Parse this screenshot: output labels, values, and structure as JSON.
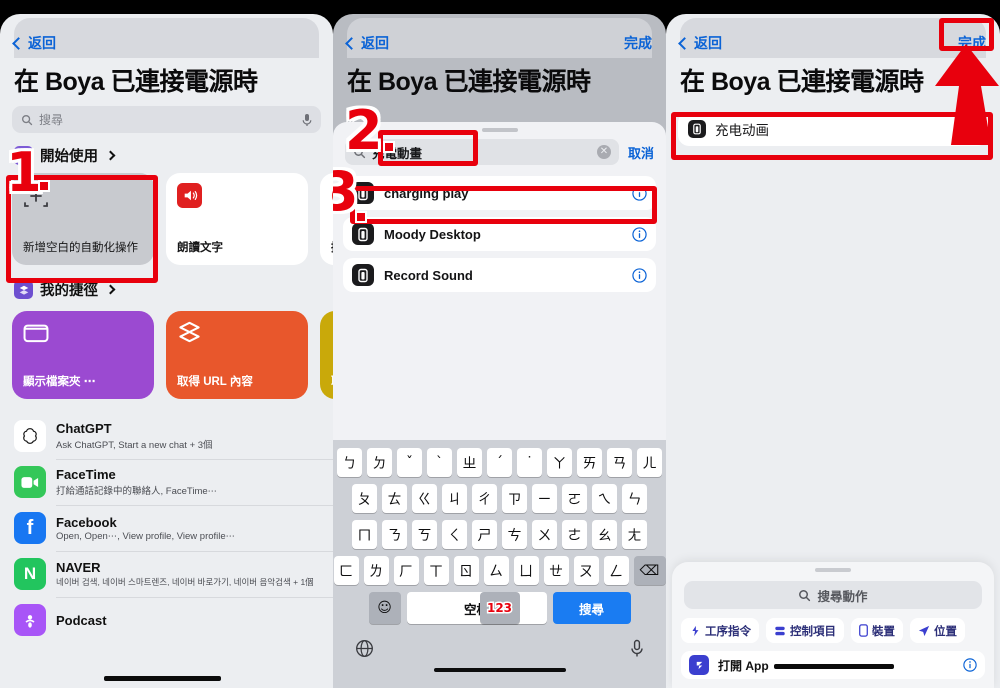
{
  "panels": {
    "left": {
      "nav": {
        "back": "返回"
      },
      "title": "在 Boya 已連接電源時",
      "search": {
        "placeholder": "搜尋"
      },
      "sections": [
        {
          "label": "開始使用"
        },
        {
          "label": "我的捷徑"
        }
      ],
      "starter_cards": [
        {
          "label": "新增空白的自動化操作",
          "icon": "add-blank-automation-icon"
        },
        {
          "label": "朗讀文字",
          "icon": "speaker-icon"
        },
        {
          "label": "播放",
          "icon": "red-circle-icon"
        }
      ],
      "shortcut_tiles": [
        {
          "label": "顯示檔案夾 ⋯",
          "color": "#9b4ad1",
          "icon": "folder-icon"
        },
        {
          "label": "取得 URL 內容",
          "color": "#e8572c",
          "icon": "layers-icon"
        },
        {
          "label": "取得",
          "color": "#c9a90a",
          "icon": "layers-icon"
        }
      ],
      "apps": [
        {
          "name": "ChatGPT",
          "sub": "Ask ChatGPT, Start a new chat + 3個",
          "color": "#ffffff",
          "glyph": "✺"
        },
        {
          "name": "FaceTime",
          "sub": "打給通話記錄中的聯絡人, FaceTime⋯",
          "color": "#34c759",
          "glyph": "▣"
        },
        {
          "name": "Facebook",
          "sub": "Open, Open⋯, View profile, View profile⋯",
          "color": "#1877f2",
          "glyph": "f"
        },
        {
          "name": "NAVER",
          "sub": "네이버 검색, 네이버 스마트렌즈, 네이버 바로가기, 네이버 음악검색 + 1個",
          "color": "#22c55e",
          "glyph": "N"
        },
        {
          "name": "Podcast",
          "sub": "",
          "color": "#a855f7",
          "glyph": "◉"
        }
      ]
    },
    "middle": {
      "nav": {
        "back": "返回",
        "done": "完成"
      },
      "title": "在 Boya 已連接電源時",
      "search": {
        "value": "充電動畫",
        "cancel": "取消",
        "clear": "✕"
      },
      "results": [
        {
          "name": "charging play",
          "icon": "battery-icon",
          "info": "info-icon"
        },
        {
          "name": "Moody Desktop",
          "icon": "battery-icon",
          "info": "info-icon"
        },
        {
          "name": "Record Sound",
          "icon": "battery-icon",
          "info": "info-icon"
        }
      ],
      "keyboard": {
        "rows": [
          [
            "ㄅ",
            "ㄉ",
            "ˇ",
            "ˋ",
            "ㄓ",
            "ˊ",
            "˙",
            "ㄚ",
            "ㄞ",
            "ㄢ",
            "ㄦ"
          ],
          [
            "ㄆ",
            "ㄊ",
            "ㄍ",
            "ㄐ",
            "ㄔ",
            "ㄗ",
            "ㄧ",
            "ㄛ",
            "ㄟ",
            "ㄣ"
          ],
          [
            "ㄇ",
            "ㄋ",
            "ㄎ",
            "ㄑ",
            "ㄕ",
            "ㄘ",
            "ㄨ",
            "ㄜ",
            "ㄠ",
            "ㄤ"
          ],
          [
            "ㄈ",
            "ㄌ",
            "ㄏ",
            "ㄒ",
            "ㄖ",
            "ㄙ",
            "ㄩ",
            "ㄝ",
            "ㄡ",
            "ㄥ"
          ]
        ],
        "delete": "⌫",
        "numbers": "123",
        "emoji": "☺",
        "space": "空格",
        "go": "搜尋"
      }
    },
    "right": {
      "nav": {
        "back": "返回",
        "done": "完成"
      },
      "title": "在 Boya 已連接電源時",
      "name_field": {
        "value": "充电动画",
        "icon": "battery-icon",
        "clear": "✕"
      },
      "bottom_sheet": {
        "search_placeholder": "搜尋動作",
        "chips": [
          {
            "label": "工序指令",
            "icon": "shortcuts-icon"
          },
          {
            "label": "控制項目",
            "icon": "controls-icon"
          },
          {
            "label": "裝置",
            "icon": "device-icon"
          },
          {
            "label": "位置",
            "icon": "location-icon"
          }
        ],
        "items": [
          {
            "name": "打開 App",
            "icon": "open-app-icon",
            "info": "info-icon"
          }
        ]
      }
    }
  },
  "annotations": {
    "markers": [
      "1",
      "2",
      "3"
    ],
    "accent_color": "#e8000d"
  }
}
